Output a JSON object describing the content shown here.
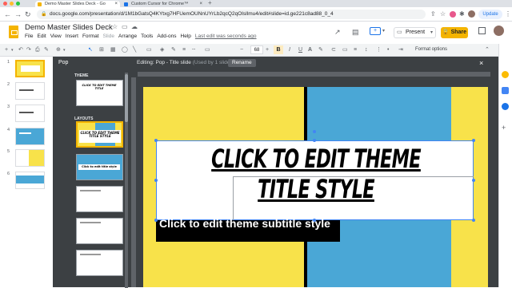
{
  "browser": {
    "tabs": [
      {
        "title": "Demo Master Slides Deck - Go",
        "active": true
      },
      {
        "title": "Custom Cursor for Chrome™",
        "active": false
      }
    ],
    "url": "docs.google.com/presentation/d/1M1bGatsQ4KYtxg7HFUemOUNnUYrLb2qcQ2qOIsllmu4/edit#slide=id.ge221c8ad88_0_4",
    "update_label": "Update"
  },
  "docs": {
    "title": "Demo Master Slides Deck",
    "menu": [
      "File",
      "Edit",
      "View",
      "Insert",
      "Format",
      "Slide",
      "Arrange",
      "Tools",
      "Add-ons",
      "Help"
    ],
    "last_edit": "Last edit was seconds ago",
    "present_label": "Present",
    "share_label": "Share",
    "brand_color": "#f4b400"
  },
  "toolbar": {
    "font_size": "68",
    "bold_label": "B",
    "italic_label": "I",
    "underline_label": "U",
    "format_options_label": "Format options"
  },
  "filmstrip": {
    "slide_numbers": [
      "1",
      "2",
      "3",
      "4",
      "5",
      "6"
    ]
  },
  "master_panel": {
    "name": "Pop",
    "theme_label": "THEME",
    "layouts_label": "LAYOUTS",
    "theme_thumb_text": "CLICK TO EDIT THEME TITLE",
    "layout1_text": "CLICK TO EDIT THEME TITLE STYLE",
    "layout2_text": "Click to edit title style"
  },
  "editor": {
    "label": "Editing: Pop - Title slide",
    "usage": "(Used by 1 slide)",
    "rename_label": "Rename",
    "close_icon": "×"
  },
  "slide": {
    "title": "CLICK TO EDIT THEME TITLE STYLE",
    "subtitle": "Click to edit theme subtitle style",
    "colors": {
      "yellow": "#f8e24a",
      "blue": "#4aa7d6",
      "black": "#000000"
    }
  }
}
